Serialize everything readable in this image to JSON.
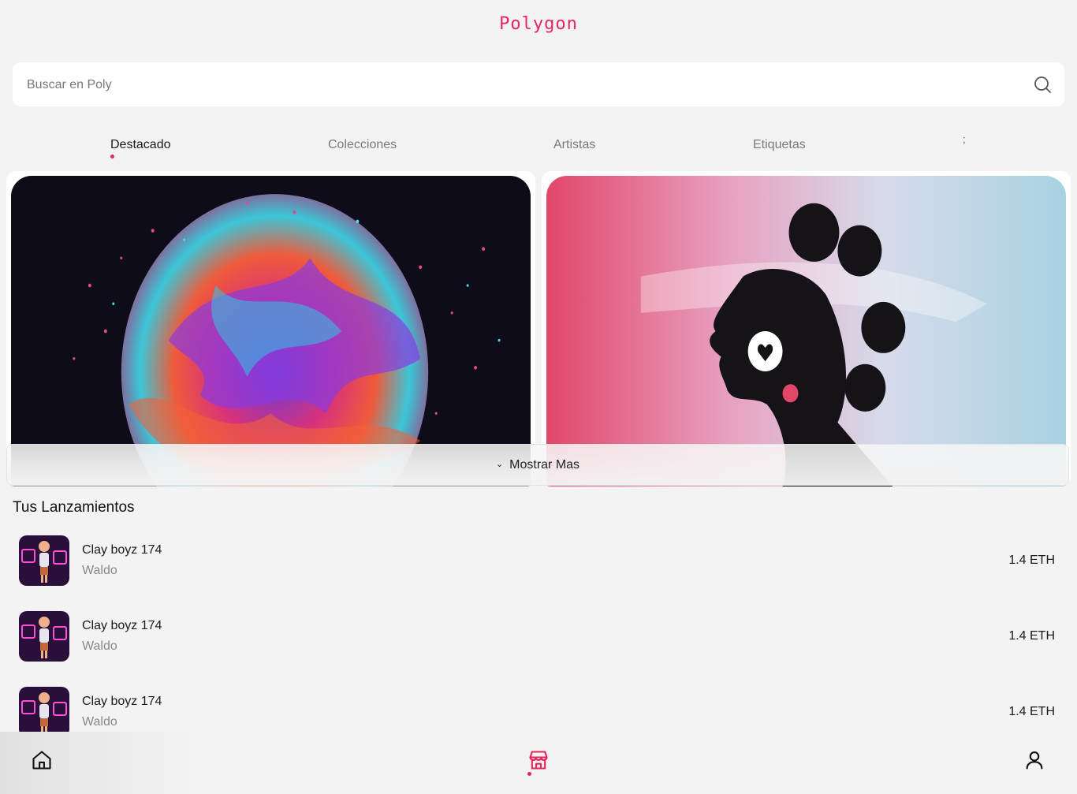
{
  "app": {
    "title": "Polygon",
    "accent_color": "#e8265e"
  },
  "search": {
    "placeholder": "Buscar en Poly",
    "value": "",
    "icon": "search-icon"
  },
  "tabs": [
    {
      "label": "Destacado",
      "active": true
    },
    {
      "label": "Colecciones",
      "active": false
    },
    {
      "label": "Artistas",
      "active": false
    },
    {
      "label": "Etiquetas",
      "active": false
    },
    {
      "label": ";",
      "active": false
    }
  ],
  "featured": {
    "show_more_label": "Mostrar Mas",
    "show_more_icon": "chevron-down-icon"
  },
  "launches": {
    "title": "Tus Lanzamientos",
    "items": [
      {
        "title": "Clay boyz 174",
        "artist": "Waldo",
        "price": "1.4 ETH"
      },
      {
        "title": "Clay boyz 174",
        "artist": "Waldo",
        "price": "1.4 ETH"
      },
      {
        "title": "Clay boyz 174",
        "artist": "Waldo",
        "price": "1.4 ETH"
      }
    ]
  },
  "bottom_nav": {
    "items": [
      {
        "icon": "home-icon",
        "active": false
      },
      {
        "icon": "store-icon",
        "active": true
      },
      {
        "icon": "user-icon",
        "active": false
      }
    ]
  }
}
